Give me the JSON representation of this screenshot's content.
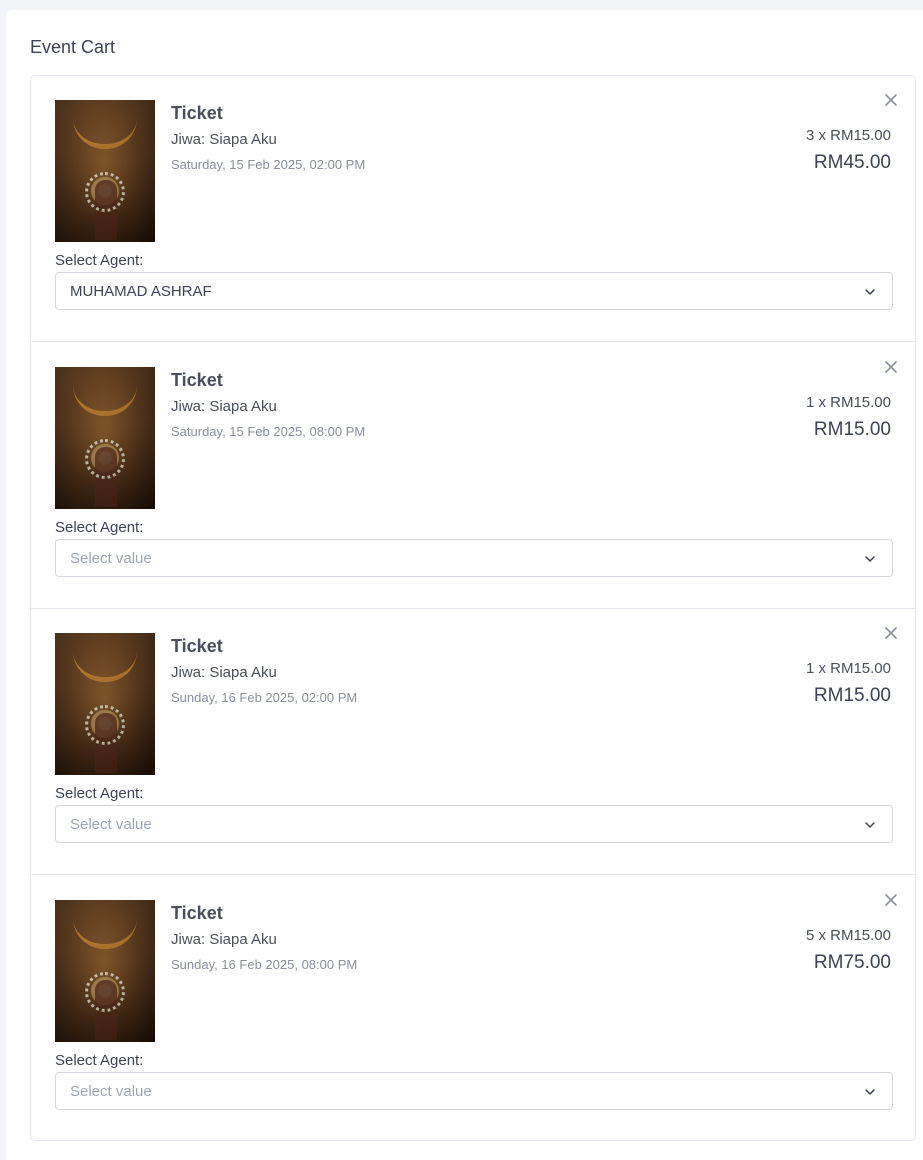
{
  "panel": {
    "title": "Event Cart"
  },
  "colors": {
    "border": "#e4e6ef",
    "text": "#3f4254",
    "muted": "#8b8f9e",
    "placeholder": "#a1a5b7"
  },
  "items": [
    {
      "title": "Ticket",
      "event": "Jiwa: Siapa Aku",
      "datetime": "Saturday, 15 Feb 2025, 02:00 PM",
      "qty_price": "3 x RM15.00",
      "total": "RM45.00",
      "agent_label": "Select Agent:",
      "agent_value": "MUHAMAD ASHRAF",
      "agent_placeholder": "",
      "remove_icon": "close-icon",
      "dropdown_icon": "chevron-down-icon"
    },
    {
      "title": "Ticket",
      "event": "Jiwa: Siapa Aku",
      "datetime": "Saturday, 15 Feb 2025, 08:00 PM",
      "qty_price": "1 x RM15.00",
      "total": "RM15.00",
      "agent_label": "Select Agent:",
      "agent_value": "",
      "agent_placeholder": "Select value",
      "remove_icon": "close-icon",
      "dropdown_icon": "chevron-down-icon"
    },
    {
      "title": "Ticket",
      "event": "Jiwa: Siapa Aku",
      "datetime": "Sunday, 16 Feb 2025, 02:00 PM",
      "qty_price": "1 x RM15.00",
      "total": "RM15.00",
      "agent_label": "Select Agent:",
      "agent_value": "",
      "agent_placeholder": "Select value",
      "remove_icon": "close-icon",
      "dropdown_icon": "chevron-down-icon"
    },
    {
      "title": "Ticket",
      "event": "Jiwa: Siapa Aku",
      "datetime": "Sunday, 16 Feb 2025, 08:00 PM",
      "qty_price": "5 x RM15.00",
      "total": "RM75.00",
      "agent_label": "Select Agent:",
      "agent_value": "",
      "agent_placeholder": "Select value",
      "remove_icon": "close-icon",
      "dropdown_icon": "chevron-down-icon"
    }
  ]
}
